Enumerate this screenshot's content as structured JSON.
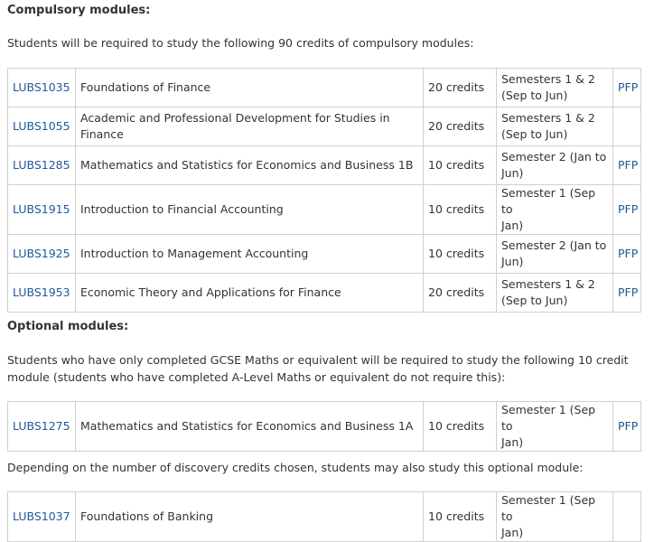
{
  "compulsory": {
    "heading": "Compulsory modules:",
    "intro": "Students will be required to study the following 90 credits of compulsory modules:",
    "rows": [
      {
        "code": "LUBS1035",
        "title": "Foundations of Finance",
        "credits": "20 credits",
        "semester_line1": "Semesters 1 & 2",
        "semester_line2": "(Sep to Jun)",
        "pfp": "PFP"
      },
      {
        "code": "LUBS1055",
        "title": "Academic and Professional Development for Studies in Finance",
        "credits": "20 credits",
        "semester_line1": "Semesters 1 & 2",
        "semester_line2": "(Sep to Jun)",
        "pfp": ""
      },
      {
        "code": "LUBS1285",
        "title": "Mathematics and Statistics for Economics and Business 1B",
        "credits": "10 credits",
        "semester_line1": "Semester 2 (Jan to",
        "semester_line2": "Jun)",
        "pfp": "PFP"
      },
      {
        "code": "LUBS1915",
        "title": "Introduction to Financial Accounting",
        "credits": "10 credits",
        "semester_line1": "Semester 1 (Sep to",
        "semester_line2": "Jan)",
        "pfp": "PFP"
      },
      {
        "code": "LUBS1925",
        "title": "Introduction to Management Accounting",
        "credits": "10 credits",
        "semester_line1": "Semester 2 (Jan to",
        "semester_line2": "Jun)",
        "pfp": "PFP"
      },
      {
        "code": "LUBS1953",
        "title": "Economic Theory and Applications for Finance",
        "credits": "20 credits",
        "semester_line1": "Semesters 1 & 2",
        "semester_line2": "(Sep to Jun)",
        "pfp": "PFP"
      }
    ]
  },
  "optional": {
    "heading": "Optional modules:",
    "intro_line1": "Students who have only completed GCSE Maths or equivalent will be required to study the following 10 credit",
    "intro_line2": "module (students who have completed A-Level Maths or equivalent do not require this):",
    "rows": [
      {
        "code": "LUBS1275",
        "title": "Mathematics and Statistics for Economics and Business 1A",
        "credits": "10 credits",
        "semester_line1": "Semester 1 (Sep to",
        "semester_line2": "Jan)",
        "pfp": "PFP"
      }
    ],
    "discovery_intro": "Depending on the number of discovery credits chosen, students may also study this optional module:",
    "discovery_rows": [
      {
        "code": "LUBS1037",
        "title": "Foundations of Banking",
        "credits": "10 credits",
        "semester_line1": "Semester 1 (Sep to",
        "semester_line2": "Jan)",
        "pfp": ""
      }
    ]
  },
  "colors": {
    "link": "#1f5a98",
    "text": "#333333",
    "border": "#cfcfcf"
  }
}
